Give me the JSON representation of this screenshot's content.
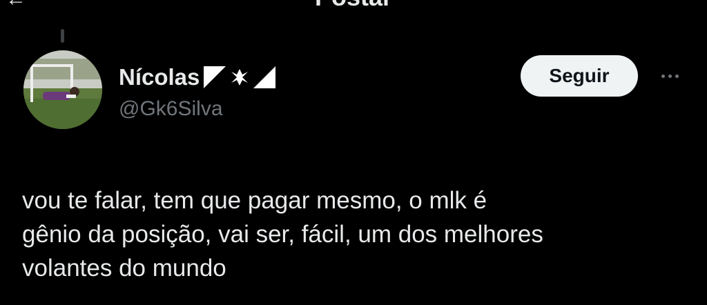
{
  "header": {
    "title": "Postar",
    "back_icon": "back-arrow-icon"
  },
  "tweet": {
    "author": {
      "display_name": "Nícolas",
      "name_emojis": [
        "flag-corner-icon",
        "maltese-cross-icon",
        "flag-corner-icon"
      ],
      "handle": "@Gk6Silva"
    },
    "follow_label": "Seguir",
    "more_icon": "more-options-icon",
    "text": "vou te falar, tem que pagar mesmo, o mlk é\ngênio da posição, vai ser, fácil, um dos melhores\nvolantes do mundo"
  },
  "colors": {
    "background": "#000000",
    "text_primary": "#e7e9ea",
    "text_secondary": "#71767b",
    "button_bg": "#eff3f4",
    "button_text": "#0f1419"
  }
}
